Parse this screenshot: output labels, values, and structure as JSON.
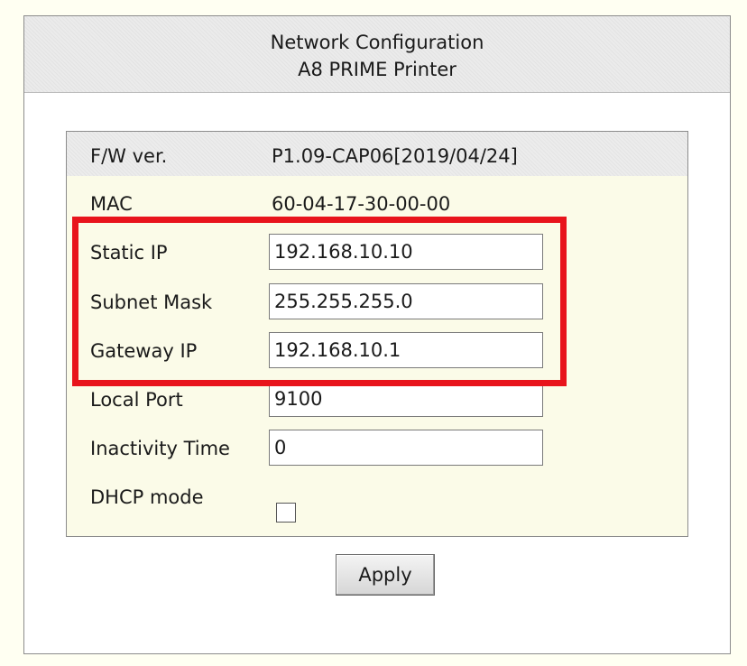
{
  "header": {
    "title": "Network Configuration",
    "subtitle": "A8 PRIME Printer"
  },
  "info": {
    "fw_label": "F/W ver.",
    "fw_value": "P1.09-CAP06[2019/04/24]",
    "mac_label": "MAC",
    "mac_value": "60-04-17-30-00-00"
  },
  "fields": {
    "static_ip": {
      "label": "Static IP",
      "value": "192.168.10.10"
    },
    "subnet_mask": {
      "label": "Subnet Mask",
      "value": "255.255.255.0"
    },
    "gateway_ip": {
      "label": "Gateway IP",
      "value": "192.168.10.1"
    },
    "local_port": {
      "label": "Local Port",
      "value": "9100"
    },
    "inactivity_time": {
      "label": "Inactivity Time",
      "value": "0"
    }
  },
  "dhcp": {
    "label": "DHCP mode",
    "checked": false
  },
  "actions": {
    "apply_label": "Apply"
  },
  "colors": {
    "page_background": "#fffff2",
    "highlight_border": "#e8141c",
    "config_background": "#fbfbe8"
  }
}
